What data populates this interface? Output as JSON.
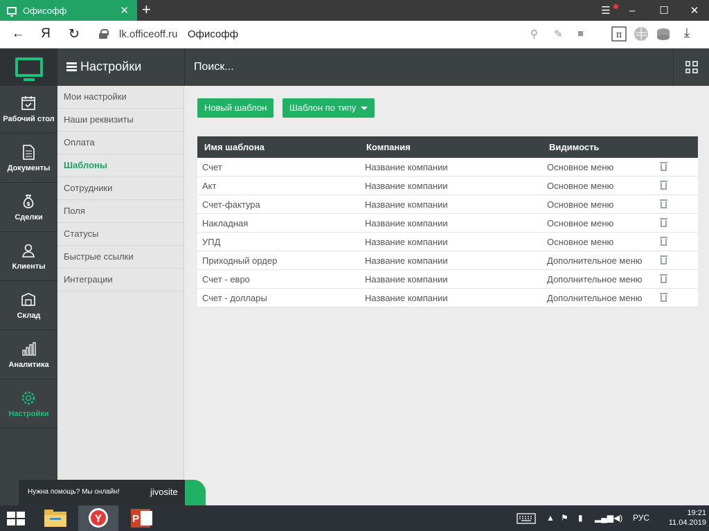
{
  "browser": {
    "tab_title": "Офисофф",
    "url": "lk.officeoff.ru",
    "page_title": "Офисофф",
    "yandex_button": "Я"
  },
  "app": {
    "section_title": "Настройки",
    "search_placeholder": "Поиск..."
  },
  "left_nav": [
    {
      "label": "Рабочий стол",
      "icon": "calendar-icon"
    },
    {
      "label": "Документы",
      "icon": "document-icon"
    },
    {
      "label": "Сделки",
      "icon": "moneybag-icon"
    },
    {
      "label": "Клиенты",
      "icon": "person-icon"
    },
    {
      "label": "Склад",
      "icon": "box-icon"
    },
    {
      "label": "Аналитика",
      "icon": "bar-chart-icon"
    },
    {
      "label": "Настройки",
      "icon": "gear-icon",
      "active": true
    }
  ],
  "settings_menu": [
    {
      "label": "Мои настройки"
    },
    {
      "label": "Наши реквизиты"
    },
    {
      "label": "Оплата"
    },
    {
      "label": "Шаблоны",
      "active": true
    },
    {
      "label": "Сотрудники"
    },
    {
      "label": "Поля"
    },
    {
      "label": "Статусы"
    },
    {
      "label": "Быстрые ссылки"
    },
    {
      "label": "Интеграции"
    }
  ],
  "buttons": {
    "new_template": "Новый шаблон",
    "template_by_type": "Шаблон по типу"
  },
  "table": {
    "columns": [
      "Имя шаблона",
      "Компания",
      "Видимость"
    ],
    "rows": [
      {
        "name": "Счет",
        "company": "Название компании",
        "visibility": "Основное меню"
      },
      {
        "name": "Акт",
        "company": "Название компании",
        "visibility": "Основное меню"
      },
      {
        "name": "Счет-фактура",
        "company": "Название компании",
        "visibility": "Основное меню"
      },
      {
        "name": "Накладная",
        "company": "Название компании",
        "visibility": "Основное меню"
      },
      {
        "name": "УПД",
        "company": "Название компании",
        "visibility": "Основное меню"
      },
      {
        "name": "Приходный ордер",
        "company": "Название компании",
        "visibility": "Дополнительное меню"
      },
      {
        "name": "Счет - евро",
        "company": "Название компании",
        "visibility": "Дополнительное меню"
      },
      {
        "name": "Счет - доллары",
        "company": "Название компании",
        "visibility": "Дополнительное меню"
      }
    ]
  },
  "jivo": {
    "text": "Нужна помощь? Мы онлайн!",
    "logo": "jivosite"
  },
  "taskbar": {
    "language": "РУС",
    "time": "19:21",
    "date": "11.04.2019"
  },
  "colors": {
    "accent": "#1fb264",
    "dark": "#3c4144"
  }
}
